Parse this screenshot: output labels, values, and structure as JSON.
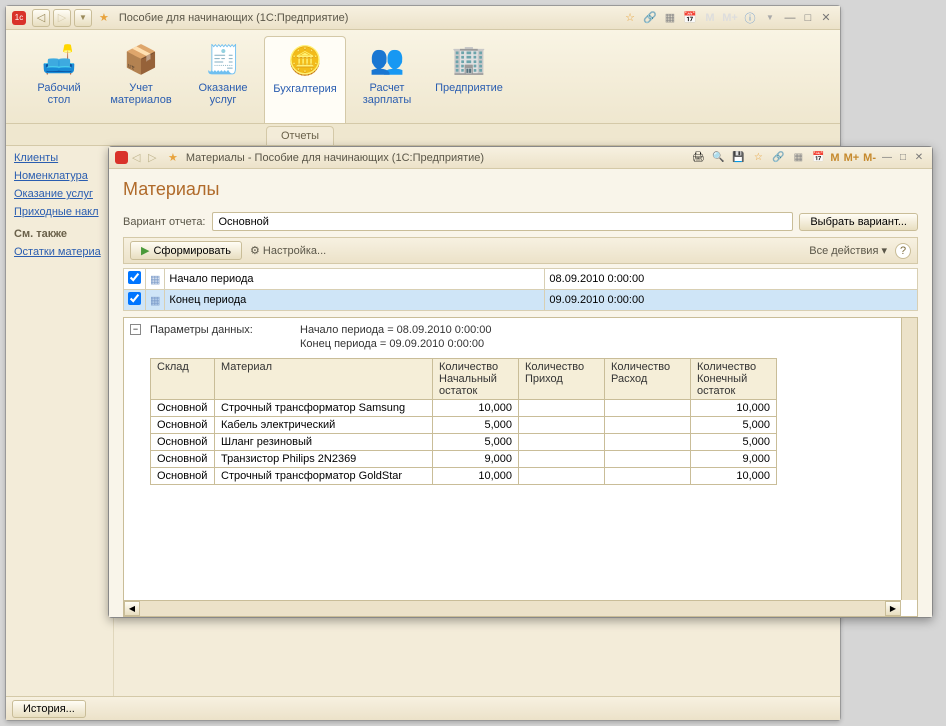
{
  "main": {
    "title": "Пособие для начинающих  (1С:Предприятие)",
    "ribbon": [
      {
        "label": "Рабочий\nстол"
      },
      {
        "label": "Учет\nматериалов"
      },
      {
        "label": "Оказание\nуслуг"
      },
      {
        "label": "Бухгалтерия"
      },
      {
        "label": "Расчет\nзарплаты"
      },
      {
        "label": "Предприятие"
      }
    ],
    "subtab": "Отчеты",
    "sidebar": {
      "links": [
        "Клиенты",
        "Номенклатура",
        "Оказание услуг",
        "Приходные накл"
      ],
      "section": "См. также",
      "extra": [
        "Остатки материа"
      ]
    },
    "history_btn": "История..."
  },
  "child": {
    "title": "Материалы - Пособие для начинающих  (1С:Предприятие)",
    "mbuttons": [
      "M",
      "M+",
      "M-"
    ],
    "report_title": "Материалы",
    "variant_label": "Вариант отчета:",
    "variant_value": "Основной",
    "choose_variant": "Выбрать вариант...",
    "generate": "Сформировать",
    "settings": "Настройка...",
    "all_actions": "Все действия ▾",
    "periods": [
      {
        "checked": true,
        "label": "Начало периода",
        "value": "08.09.2010 0:00:00",
        "selected": false
      },
      {
        "checked": true,
        "label": "Конец периода",
        "value": "09.09.2010 0:00:00",
        "selected": true
      }
    ],
    "params_title": "Параметры данных:",
    "param_lines": [
      "Начало периода = 08.09.2010 0:00:00",
      "Конец периода = 09.09.2010 0:00:00"
    ],
    "columns": [
      "Склад",
      "Материал",
      "Количество\nНачальный\nостаток",
      "Количество\nПриход",
      "Количество\nРасход",
      "Количество\nКонечный\nостаток"
    ],
    "rows": [
      {
        "sklad": "Основной",
        "mat": "Строчный трансформатор Samsung",
        "start": "10,000",
        "in": "",
        "out": "",
        "end": "10,000"
      },
      {
        "sklad": "Основной",
        "mat": "Кабель электрический",
        "start": "5,000",
        "in": "",
        "out": "",
        "end": "5,000"
      },
      {
        "sklad": "Основной",
        "mat": "Шланг резиновый",
        "start": "5,000",
        "in": "",
        "out": "",
        "end": "5,000"
      },
      {
        "sklad": "Основной",
        "mat": "Транзистор Philips 2N2369",
        "start": "9,000",
        "in": "",
        "out": "",
        "end": "9,000"
      },
      {
        "sklad": "Основной",
        "mat": "Строчный трансформатор GoldStar",
        "start": "10,000",
        "in": "",
        "out": "",
        "end": "10,000"
      }
    ]
  }
}
